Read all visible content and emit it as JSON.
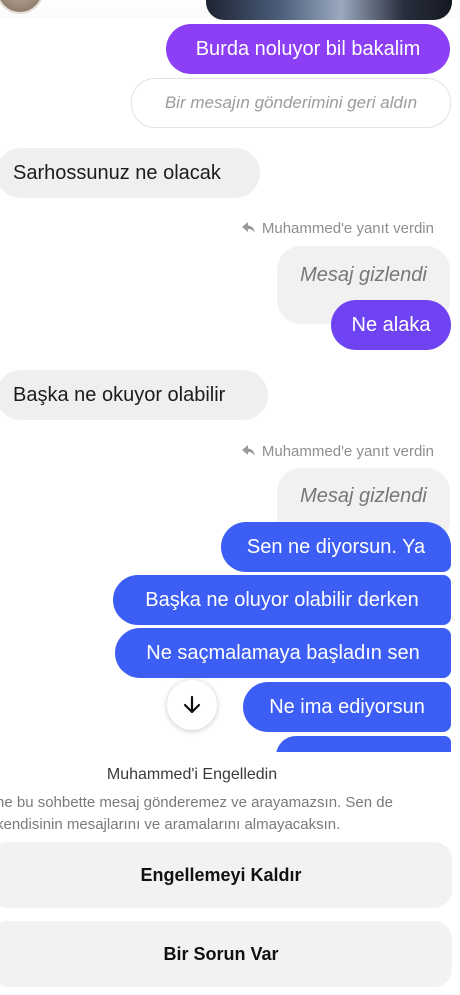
{
  "messages": {
    "burda": "Burda noluyor bil bakalim",
    "unsent_note": "Bir mesajın gönderimini geri aldın",
    "sarhos": "Sarhossunuz ne olacak",
    "reply_note_1": "Muhammed'e yanıt verdin",
    "hidden_1": "Mesaj gizlendi",
    "ne_alaka": "Ne alaka",
    "baska_okuyor": "Başka ne okuyor olabilir",
    "reply_note_2": "Muhammed'e yanıt verdin",
    "hidden_2": "Mesaj gizlendi",
    "sen_ne": "Sen ne diyorsun. Ya",
    "baska_oluyor": "Başka ne oluyor olabilir derken",
    "ne_sacmalama": "Ne saçmalamaya başladın sen",
    "ne_ima": "Ne ima ediyorsun"
  },
  "block_panel": {
    "title": "Muhammed'i Engelledin",
    "description_line_1": "ne bu sohbette mesaj gönderemez ve arayamazsın. Sen de",
    "description_line_2": "kendisinin mesajlarını ve aramalarını almayacaksın.",
    "unblock_label": "Engellemeyi Kaldır",
    "report_label": "Bir Sorun Var"
  },
  "icons": {
    "reply": "reply-arrow-icon",
    "scroll_down": "arrow-down-icon"
  },
  "colors": {
    "purple": "#8c3ff5",
    "violet": "#7043f2",
    "blue": "#3d5ef4",
    "incoming_bg": "#efefef"
  }
}
